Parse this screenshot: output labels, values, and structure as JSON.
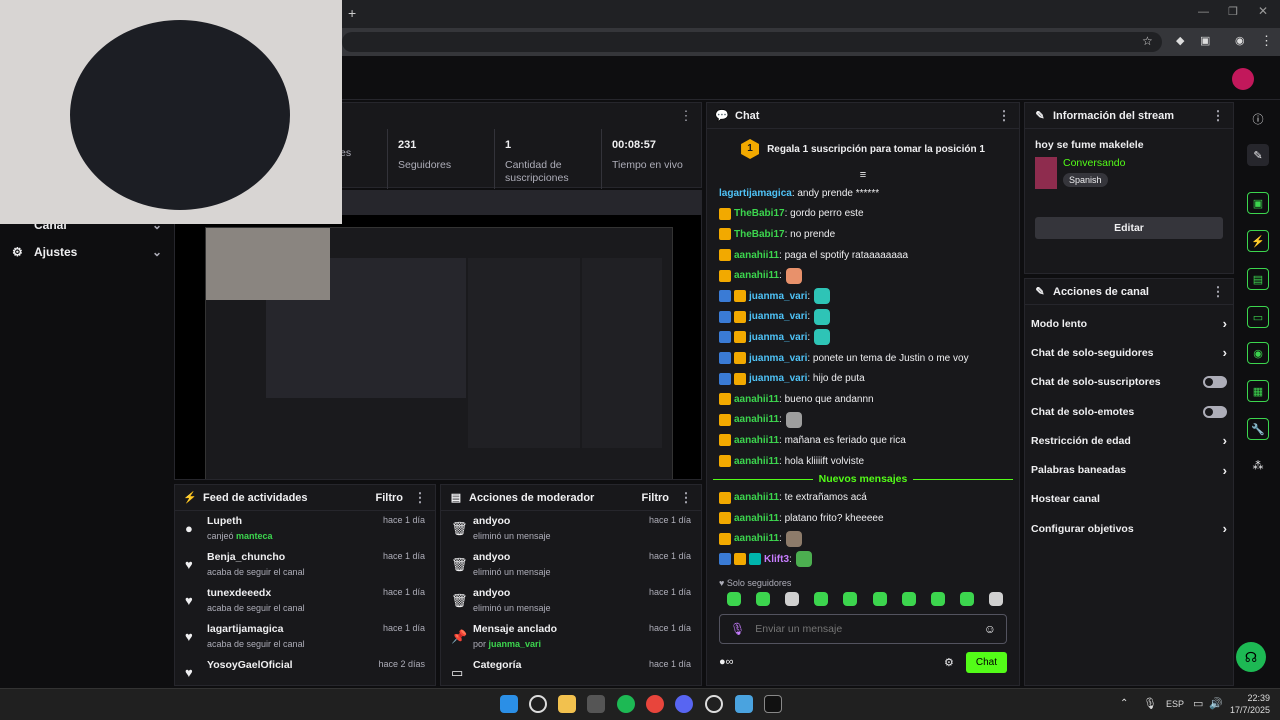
{
  "browser": {
    "new_tab": "+"
  },
  "nav": {
    "canal": "Canal",
    "ajustes": "Ajustes"
  },
  "stats": {
    "menu": "⋮",
    "items": [
      {
        "n": "",
        "l": "es"
      },
      {
        "n": "231",
        "l": "Seguidores"
      },
      {
        "n": "1",
        "l": "Cantidad de suscripciones"
      },
      {
        "n": "00:08:57",
        "l": "Tiempo en vivo"
      }
    ]
  },
  "feed": {
    "title": "Feed de actividades",
    "filter": "Filtro",
    "items": [
      {
        "name": "Lupeth",
        "sub": "canjeó ",
        "reward": "manteca",
        "time": "hace 1 día"
      },
      {
        "name": "Benja_chuncho",
        "sub": "acaba de seguir el canal",
        "reward": "",
        "time": "hace 1 día"
      },
      {
        "name": "tunexdeeedx",
        "sub": "acaba de seguir el canal",
        "reward": "",
        "time": "hace 1 día"
      },
      {
        "name": "lagartijamagica",
        "sub": "acaba de seguir el canal",
        "reward": "",
        "time": "hace 1 día"
      },
      {
        "name": "YosoyGaelOficial",
        "sub": "",
        "reward": "",
        "time": "hace 2 días"
      }
    ]
  },
  "mod": {
    "title": "Acciones de moderador",
    "filter": "Filtro",
    "items": [
      {
        "name": "andyoo",
        "sub": "eliminó un mensaje",
        "user": "",
        "time": "hace 1 día"
      },
      {
        "name": "andyoo",
        "sub": "eliminó un mensaje",
        "user": "",
        "time": "hace 1 día"
      },
      {
        "name": "andyoo",
        "sub": "eliminó un mensaje",
        "user": "",
        "time": "hace 1 día"
      },
      {
        "name": "Mensaje anclado",
        "sub": "por ",
        "user": "juanma_vari",
        "time": "hace 1 día"
      },
      {
        "name": "Categoría",
        "sub": "",
        "user": "",
        "time": "hace 1 día"
      }
    ]
  },
  "chat": {
    "title": "Chat",
    "gift_rank": "1",
    "gift_text": "Regala 1 suscripción para tomar la posición 1",
    "messages": [
      {
        "user": "lagartijamagica",
        "text": ": andy prende ******",
        "color": "#4fc3f7",
        "badges": [],
        "emote": ""
      },
      {
        "user": "TheBabi17",
        "text": ": gordo perro este",
        "color": "#3cd54e",
        "badges": [
          "crown"
        ],
        "emote": ""
      },
      {
        "user": "TheBabi17",
        "text": ": no prende",
        "color": "#3cd54e",
        "badges": [
          "crown"
        ],
        "emote": ""
      },
      {
        "user": "aanahii11",
        "text": ": paga el spotify rataaaaaaaa",
        "color": "#3cd54e",
        "badges": [
          "crown"
        ],
        "emote": ""
      },
      {
        "user": "aanahii11",
        "text": ":",
        "color": "#3cd54e",
        "badges": [
          "crown"
        ],
        "emote": "#e8916b"
      },
      {
        "user": "juanma_vari",
        "text": ":",
        "color": "#4fc3f7",
        "badges": [
          "vipb",
          "crown"
        ],
        "emote": "#2ec4b6"
      },
      {
        "user": "juanma_vari",
        "text": ":",
        "color": "#4fc3f7",
        "badges": [
          "vipb",
          "crown"
        ],
        "emote": "#2ec4b6"
      },
      {
        "user": "juanma_vari",
        "text": ":",
        "color": "#4fc3f7",
        "badges": [
          "vipb",
          "crown"
        ],
        "emote": "#2ec4b6"
      },
      {
        "user": "juanma_vari",
        "text": ": ponete un tema de Justin o me voy",
        "color": "#4fc3f7",
        "badges": [
          "vipb",
          "crown"
        ],
        "emote": ""
      },
      {
        "user": "juanma_vari",
        "text": ": hijo de puta",
        "color": "#4fc3f7",
        "badges": [
          "vipb",
          "crown"
        ],
        "emote": ""
      },
      {
        "user": "aanahii11",
        "text": ": bueno que andannn",
        "color": "#3cd54e",
        "badges": [
          "crown"
        ],
        "emote": ""
      },
      {
        "user": "aanahii11",
        "text": ":",
        "color": "#3cd54e",
        "badges": [
          "crown"
        ],
        "emote": "#9e9e9e"
      },
      {
        "user": "aanahii11",
        "text": ": mañana es feriado que rica",
        "color": "#3cd54e",
        "badges": [
          "crown"
        ],
        "emote": ""
      },
      {
        "user": "aanahii11",
        "text": ": hola kliiiift volviste",
        "color": "#3cd54e",
        "badges": [
          "crown"
        ],
        "emote": ""
      }
    ],
    "new_label": "Nuevos mensajes",
    "new_messages": [
      {
        "user": "aanahii11",
        "text": ": te extrañamos acá",
        "color": "#3cd54e",
        "badges": [
          "crown"
        ],
        "emote": ""
      },
      {
        "user": "aanahii11",
        "text": ": platano frito? kheeeee",
        "color": "#3cd54e",
        "badges": [
          "crown"
        ],
        "emote": ""
      },
      {
        "user": "aanahii11",
        "text": ":",
        "color": "#3cd54e",
        "badges": [
          "crown"
        ],
        "emote": "#8d7b6a"
      },
      {
        "user": "Klift3",
        "text": ":",
        "color": "#c77dff",
        "badges": [
          "vipb",
          "crown",
          "subb"
        ],
        "emote": "#4caf50"
      }
    ],
    "followers_only": "Solo seguidores",
    "placeholder": "Enviar un mensaje",
    "send": "Chat"
  },
  "info": {
    "title": "Información del stream",
    "stream_title": "hoy se fume makelele",
    "category": "Conversando",
    "language": "Spanish",
    "edit": "Editar"
  },
  "actions": {
    "title": "Acciones de canal",
    "items": [
      {
        "label": "Modo lento",
        "control": "arrow"
      },
      {
        "label": "Chat de solo-seguidores",
        "control": "arrow"
      },
      {
        "label": "Chat de solo-suscriptores",
        "control": "toggle"
      },
      {
        "label": "Chat de solo-emotes",
        "control": "toggle"
      },
      {
        "label": "Restricción de edad",
        "control": "arrow"
      },
      {
        "label": "Palabras baneadas",
        "control": "arrow"
      },
      {
        "label": "Hostear canal",
        "control": "none"
      },
      {
        "label": "Configurar objetivos",
        "control": "arrow"
      }
    ]
  },
  "taskbar": {
    "lang": "ESP",
    "time": "22:39",
    "date": "17/7/2025"
  },
  "colors": {
    "accent": "#53fc18",
    "bg": "#0e0e10",
    "panel": "#18181b"
  }
}
